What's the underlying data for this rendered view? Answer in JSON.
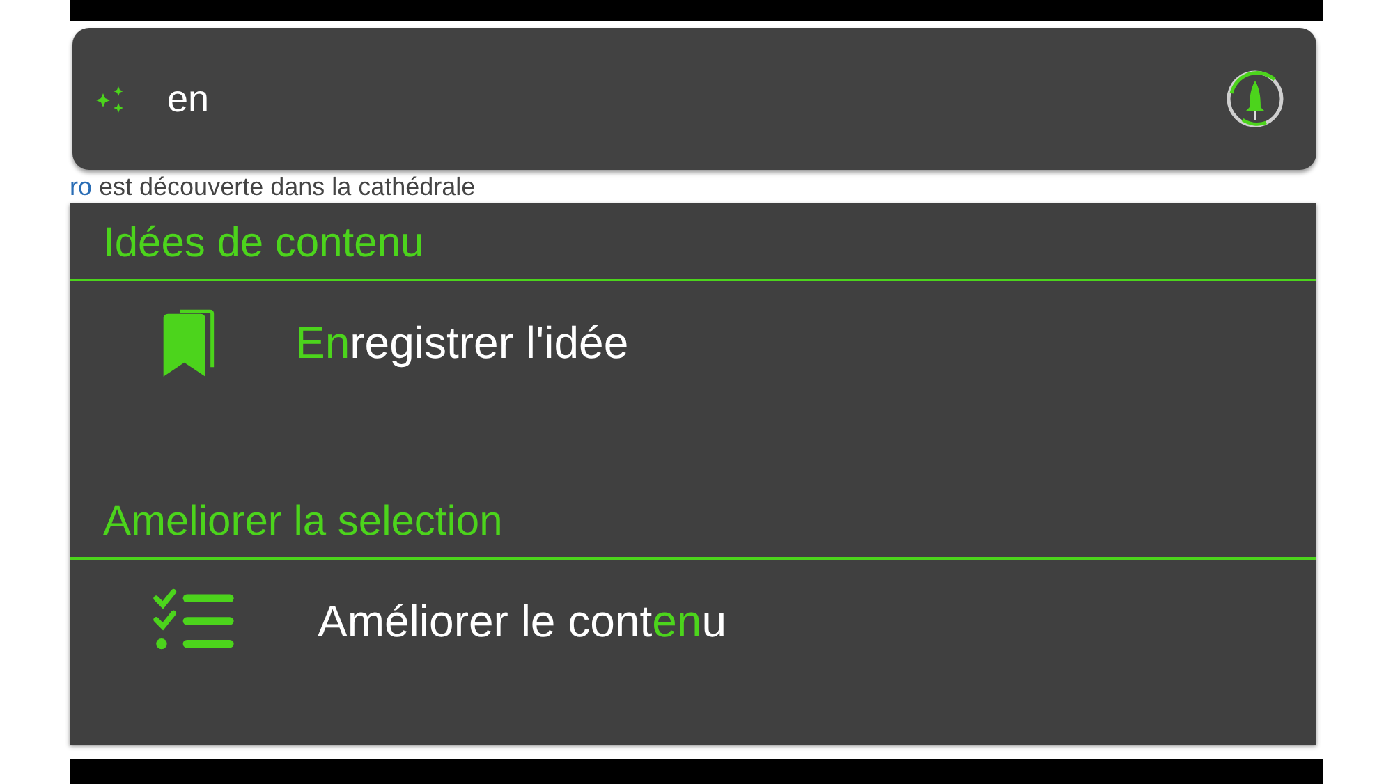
{
  "search": {
    "value": "en"
  },
  "background_text": {
    "link": "ro",
    "rest": " est découverte dans la cathédrale"
  },
  "sections": [
    {
      "title": "Idées de contenu",
      "items": [
        {
          "kind": "bookmark",
          "segments": [
            {
              "text": "En",
              "match": true
            },
            {
              "text": "registrer l'idée",
              "match": false
            }
          ]
        }
      ]
    },
    {
      "title": "Ameliorer la selection",
      "items": [
        {
          "kind": "checklist",
          "segments": [
            {
              "text": "Améliorer le cont",
              "match": false
            },
            {
              "text": "en",
              "match": true
            },
            {
              "text": "u",
              "match": false
            }
          ]
        }
      ]
    }
  ]
}
